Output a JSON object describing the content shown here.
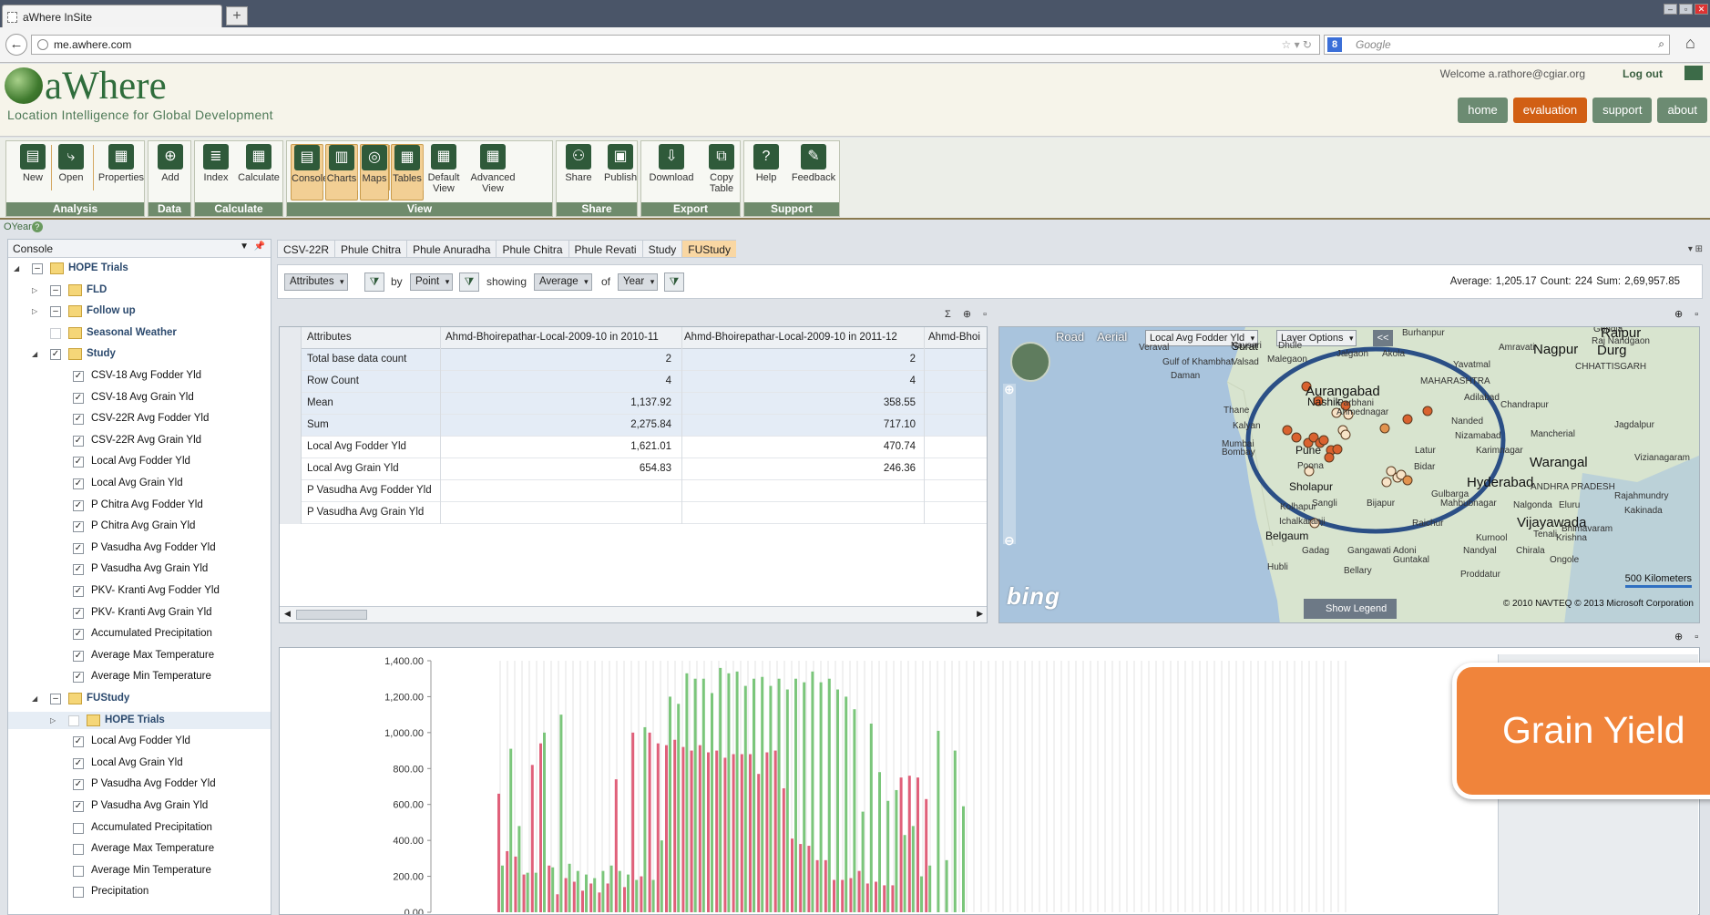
{
  "browser": {
    "tab_title": "aWhere InSite",
    "new_tab": "+",
    "url_prefix": "me.",
    "url_domain": "awhere.com",
    "search_placeholder": "Google",
    "search_engine_letter": "8"
  },
  "header": {
    "logo_text": "aWhere",
    "tagline": "Location Intelligence for Global Development",
    "welcome": "Welcome a.rathore@cgiar.org",
    "logout": "Log out",
    "nav": [
      "home",
      "evaluation",
      "support",
      "about"
    ],
    "nav_active": "evaluation"
  },
  "ribbon": {
    "groups": [
      {
        "title": "Analysis",
        "buttons": [
          "New",
          "Open",
          "Properties"
        ]
      },
      {
        "title": "Data",
        "buttons": [
          "Add"
        ]
      },
      {
        "title": "Calculate",
        "buttons": [
          "Index",
          "Calculate"
        ]
      },
      {
        "title": "View",
        "buttons": [
          "Console",
          "Charts",
          "Maps",
          "Tables",
          "Default View",
          "Advanced View"
        ]
      },
      {
        "title": "Share",
        "buttons": [
          "Share",
          "Publish"
        ]
      },
      {
        "title": "Export",
        "buttons": [
          "Download",
          "Copy Table"
        ]
      },
      {
        "title": "Support",
        "buttons": [
          "Help",
          "Feedback"
        ]
      }
    ],
    "default_view_lines": [
      "Default",
      "View"
    ],
    "advanced_view_lines": [
      "Advanced",
      "View"
    ],
    "copy_table_lines": [
      "Copy",
      "Table"
    ]
  },
  "oyear_label": "OYear",
  "sidebar": {
    "title": "Console",
    "tree": [
      {
        "label": "HOPE Trials",
        "level": 0,
        "folder": true,
        "checkbox": "minus",
        "bold": true,
        "expand": "open"
      },
      {
        "label": "FLD",
        "level": 1,
        "folder": true,
        "checkbox": "minus",
        "bold": true,
        "expand": "closed"
      },
      {
        "label": "Follow up",
        "level": 1,
        "folder": true,
        "checkbox": "minus",
        "bold": true,
        "expand": "closed"
      },
      {
        "label": "Seasonal Weather",
        "level": 1,
        "folder": true,
        "checkbox": "empty",
        "bold": true,
        "expand": "none"
      },
      {
        "label": "Study",
        "level": 1,
        "folder": true,
        "checkbox": "checked",
        "bold": true,
        "expand": "open"
      },
      {
        "label": "CSV-18 Avg Fodder Yld",
        "level": 2,
        "checkbox": "checked"
      },
      {
        "label": "CSV-18 Avg Grain Yld",
        "level": 2,
        "checkbox": "checked"
      },
      {
        "label": "CSV-22R Avg Fodder Yld",
        "level": 2,
        "checkbox": "checked"
      },
      {
        "label": "CSV-22R Avg Grain Yld",
        "level": 2,
        "checkbox": "checked"
      },
      {
        "label": "Local Avg Fodder Yld",
        "level": 2,
        "checkbox": "checked"
      },
      {
        "label": "Local Avg Grain Yld",
        "level": 2,
        "checkbox": "checked"
      },
      {
        "label": "P Chitra Avg Fodder Yld",
        "level": 2,
        "checkbox": "checked"
      },
      {
        "label": "P Chitra Avg Grain Yld",
        "level": 2,
        "checkbox": "checked"
      },
      {
        "label": "P Vasudha Avg Fodder Yld",
        "level": 2,
        "checkbox": "checked"
      },
      {
        "label": "P Vasudha Avg Grain Yld",
        "level": 2,
        "checkbox": "checked"
      },
      {
        "label": "PKV- Kranti Avg Fodder Yld",
        "level": 2,
        "checkbox": "checked"
      },
      {
        "label": "PKV- Kranti Avg Grain Yld",
        "level": 2,
        "checkbox": "checked"
      },
      {
        "label": "Accumulated Precipitation",
        "level": 2,
        "checkbox": "checked"
      },
      {
        "label": "Average Max Temperature",
        "level": 2,
        "checkbox": "checked"
      },
      {
        "label": "Average Min Temperature",
        "level": 2,
        "checkbox": "checked"
      },
      {
        "label": "FUStudy",
        "level": 1,
        "folder": true,
        "checkbox": "minus",
        "bold": true,
        "expand": "open"
      },
      {
        "label": "HOPE Trials",
        "level": 2,
        "folder": true,
        "checkbox": "empty",
        "bold": true,
        "expand": "closed",
        "selected": true
      },
      {
        "label": "Local Avg Fodder Yld",
        "level": 2,
        "checkbox": "checked"
      },
      {
        "label": "Local Avg Grain Yld",
        "level": 2,
        "checkbox": "checked"
      },
      {
        "label": "P Vasudha Avg Fodder Yld",
        "level": 2,
        "checkbox": "checked"
      },
      {
        "label": "P Vasudha Avg Grain Yld",
        "level": 2,
        "checkbox": "checked"
      },
      {
        "label": "Accumulated Precipitation",
        "level": 2,
        "checkbox": "empty"
      },
      {
        "label": "Average Max Temperature",
        "level": 2,
        "checkbox": "empty"
      },
      {
        "label": "Average Min Temperature",
        "level": 2,
        "checkbox": "empty"
      },
      {
        "label": "Precipitation",
        "level": 2,
        "checkbox": "empty"
      }
    ]
  },
  "content_tabs": [
    "CSV-22R",
    "Phule Chitra",
    "Phule Anuradha",
    "Phule Chitra",
    "Phule Revati",
    "Study",
    "FUStudy"
  ],
  "content_tabs_active": "FUStudy",
  "filterbar": {
    "attribute": "Attributes",
    "by_label": "by",
    "by_value": "Point",
    "showing_label": "showing",
    "showing_value": "Average",
    "of_label": "of",
    "of_value": "Year",
    "stats": "Average: 1,205.17  Count: 224  Sum: 2,69,957.85"
  },
  "table": {
    "headers": [
      "Attributes",
      "Ahmd-Bhoirepathar-Local-2009-10 in 2010-11",
      "Ahmd-Bhoirepathar-Local-2009-10 in 2011-12",
      "Ahmd-Bhoi"
    ],
    "rows": [
      {
        "label": "Total base data count",
        "v1": "2",
        "v2": "2",
        "hl": true
      },
      {
        "label": "Row Count",
        "v1": "4",
        "v2": "4",
        "hl": true
      },
      {
        "label": "Mean",
        "v1": "1,137.92",
        "v2": "358.55",
        "hl": true
      },
      {
        "label": "Sum",
        "v1": "2,275.84",
        "v2": "717.10",
        "hl": true
      },
      {
        "label": "Local Avg Fodder Yld",
        "v1": "1,621.01",
        "v2": "470.74",
        "hl": false
      },
      {
        "label": "Local Avg Grain Yld",
        "v1": "654.83",
        "v2": "246.36",
        "hl": false
      },
      {
        "label": "P Vasudha Avg Fodder Yld",
        "v1": "",
        "v2": "",
        "hl": false
      },
      {
        "label": "P Vasudha Avg Grain Yld",
        "v1": "",
        "v2": "",
        "hl": false
      }
    ]
  },
  "map": {
    "road": "Road",
    "aerial": "Aerial",
    "layer_select": "Local Avg Fodder Yld",
    "layer_options": "Layer Options",
    "collapse": "<<",
    "bing": "bing",
    "show_legend": "Show Legend",
    "scale": "500 Kilometers",
    "copyright": "© 2010 NAVTEQ   © 2013 Microsoft Corporation",
    "cities": [
      {
        "name": "Burhanpur",
        "size": "sm"
      },
      {
        "name": "Raipur",
        "size": "big"
      },
      {
        "name": "Raj Nandgaon",
        "size": "sm"
      },
      {
        "name": "Gondia",
        "size": "sm"
      },
      {
        "name": "Nagpur",
        "size": "big"
      },
      {
        "name": "Durg",
        "size": "big"
      },
      {
        "name": "Amravati",
        "size": "sm"
      },
      {
        "name": "Surat",
        "size": "n"
      },
      {
        "name": "Navsari",
        "size": "sm"
      },
      {
        "name": "Dhule",
        "size": "sm"
      },
      {
        "name": "Jalgaon",
        "size": "sm"
      },
      {
        "name": "Akola",
        "size": "sm"
      },
      {
        "name": "Yavatmal",
        "size": "sm"
      },
      {
        "name": "CHHATTISGARH",
        "size": "sm"
      },
      {
        "name": "Veraval",
        "size": "sm"
      },
      {
        "name": "Gulf of Khambhat",
        "size": "sm"
      },
      {
        "name": "Valsad",
        "size": "sm"
      },
      {
        "name": "Malegaon",
        "size": "sm"
      },
      {
        "name": "Daman",
        "size": "sm"
      },
      {
        "name": "Aurangabad",
        "size": "big"
      },
      {
        "name": "MAHARASHTRA",
        "size": "sm"
      },
      {
        "name": "Adilabad",
        "size": "sm"
      },
      {
        "name": "Nashik",
        "size": "n"
      },
      {
        "name": "Parbhani",
        "size": "sm"
      },
      {
        "name": "Chandrapur",
        "size": "sm"
      },
      {
        "name": "Thane",
        "size": "sm"
      },
      {
        "name": "Ahmednagar",
        "size": "sm"
      },
      {
        "name": "Nanded",
        "size": "sm"
      },
      {
        "name": "Kalyan",
        "size": "sm"
      },
      {
        "name": "Nizamabad",
        "size": "sm"
      },
      {
        "name": "Mancherial",
        "size": "sm"
      },
      {
        "name": "Jagdalpur",
        "size": "sm"
      },
      {
        "name": "Mumbai",
        "size": "sm"
      },
      {
        "name": "Bombay",
        "size": "sm"
      },
      {
        "name": "Pune",
        "size": "n"
      },
      {
        "name": "Latur",
        "size": "sm"
      },
      {
        "name": "Karimnagar",
        "size": "sm"
      },
      {
        "name": "Warangal",
        "size": "big"
      },
      {
        "name": "Vizianagaram",
        "size": "sm"
      },
      {
        "name": "Poona",
        "size": "sm"
      },
      {
        "name": "Bidar",
        "size": "sm"
      },
      {
        "name": "Hyderabad",
        "size": "big"
      },
      {
        "name": "Sholapur",
        "size": "n"
      },
      {
        "name": "ANDHRA PRADESH",
        "size": "sm"
      },
      {
        "name": "Rajahmundry",
        "size": "sm"
      },
      {
        "name": "Gulbarga",
        "size": "sm"
      },
      {
        "name": "Mahbubnagar",
        "size": "sm"
      },
      {
        "name": "Kolhapur",
        "size": "sm"
      },
      {
        "name": "Sangli",
        "size": "sm"
      },
      {
        "name": "Bijapur",
        "size": "sm"
      },
      {
        "name": "Nalgonda",
        "size": "sm"
      },
      {
        "name": "Eluru",
        "size": "sm"
      },
      {
        "name": "Kakinada",
        "size": "sm"
      },
      {
        "name": "Ichalkaranji",
        "size": "sm"
      },
      {
        "name": "Raichur",
        "size": "sm"
      },
      {
        "name": "Vijayawada",
        "size": "big"
      },
      {
        "name": "Bhimavaram",
        "size": "sm"
      },
      {
        "name": "Belgaum",
        "size": "n"
      },
      {
        "name": "Kurnool",
        "size": "sm"
      },
      {
        "name": "Tenali",
        "size": "sm"
      },
      {
        "name": "Krishna",
        "size": "sm"
      },
      {
        "name": "Gadag",
        "size": "sm"
      },
      {
        "name": "Gangawati",
        "size": "sm"
      },
      {
        "name": "Adoni",
        "size": "sm"
      },
      {
        "name": "Nandyal",
        "size": "sm"
      },
      {
        "name": "Chirala",
        "size": "sm"
      },
      {
        "name": "Guntakal",
        "size": "sm"
      },
      {
        "name": "Ongole",
        "size": "sm"
      },
      {
        "name": "Hubli",
        "size": "sm"
      },
      {
        "name": "Bellary",
        "size": "sm"
      },
      {
        "name": "Proddatur",
        "size": "sm"
      }
    ]
  },
  "chart_data": {
    "type": "bar",
    "title": "",
    "xlabel": "",
    "ylabel": "",
    "ylim": [
      0,
      1400
    ],
    "y_ticks": [
      "1,400.00",
      "1,200.00",
      "1,000.00",
      "800.00",
      "600.00",
      "400.00",
      "200.00",
      "0.00"
    ],
    "series": [
      {
        "name": "",
        "color": "#e0607a",
        "values": [
          660,
          340,
          310,
          210,
          820,
          940,
          260,
          100,
          190,
          170,
          120,
          160,
          110,
          160,
          740,
          140,
          1000,
          200,
          1000,
          940,
          930,
          960,
          920,
          900,
          930,
          890,
          900,
          860,
          880,
          880,
          880,
          770,
          890,
          900,
          690,
          410,
          380,
          370,
          290,
          290,
          180,
          180,
          190,
          230,
          160,
          170,
          150,
          150,
          750,
          760,
          750,
          630
        ]
      },
      {
        "name": "",
        "color": "#7bc67b",
        "values": [
          260,
          910,
          480,
          220,
          220,
          1000,
          250,
          1100,
          270,
          230,
          210,
          190,
          230,
          260,
          230,
          210,
          180,
          1030,
          180,
          400,
          1200,
          1160,
          1330,
          1300,
          1300,
          1220,
          1360,
          1330,
          1340,
          1260,
          1300,
          1310,
          1260,
          1300,
          1240,
          1300,
          1280,
          1340,
          1280,
          1300,
          1240,
          1200,
          1130,
          560,
          1050,
          780,
          620,
          680,
          430,
          480,
          200,
          260,
          1010,
          290,
          900,
          590
        ]
      }
    ]
  },
  "overlay": {
    "label": "Grain Yield"
  }
}
